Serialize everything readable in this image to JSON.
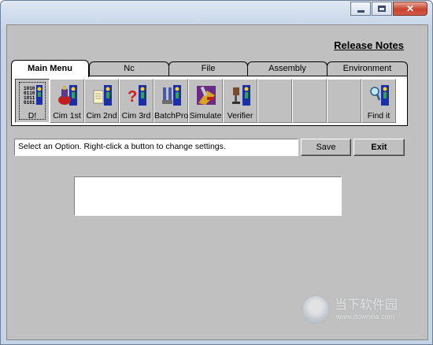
{
  "window": {
    "title": "",
    "caption_buttons": [
      {
        "name": "minimize",
        "icon": "minimize-icon"
      },
      {
        "name": "maximize",
        "icon": "maximize-icon"
      },
      {
        "name": "close",
        "icon": "close-icon",
        "glyph": "✕"
      }
    ]
  },
  "header": {
    "release_notes": "Release Notes"
  },
  "tabs": [
    {
      "label": "Main Menu",
      "active": true
    },
    {
      "label": "Nc",
      "active": false
    },
    {
      "label": "File",
      "active": false
    },
    {
      "label": "Assembly",
      "active": false
    },
    {
      "label": "Environment",
      "active": false
    }
  ],
  "toolbar": {
    "buttons": [
      {
        "label": "D!",
        "icon": "binary-data-icon",
        "pressed": true
      },
      {
        "label": "Cim 1st",
        "icon": "cim-1st-icon"
      },
      {
        "label": "Cim 2nd",
        "icon": "cim-2nd-icon"
      },
      {
        "label": "Cim 3rd",
        "icon": "cim-3rd-icon"
      },
      {
        "label": "BatchPro",
        "icon": "batchpro-icon"
      },
      {
        "label": "Simulate",
        "icon": "simulate-icon"
      },
      {
        "label": "Verifier",
        "icon": "verifier-icon"
      },
      {
        "label": "",
        "icon": ""
      },
      {
        "label": "",
        "icon": ""
      },
      {
        "label": "",
        "icon": ""
      },
      {
        "label": "Find it",
        "icon": "find-it-icon"
      }
    ]
  },
  "status": {
    "message": "Select an Option. Right-click a button to change settings.",
    "save_label": "Save",
    "exit_label": "Exit"
  },
  "watermark": {
    "text_cn": "当下软件园",
    "url": "www.downxia.com"
  },
  "colors": {
    "face": "#c0c0c0",
    "window": "#ffffff",
    "close": "#c8442f",
    "frame": "#c4d3e6"
  }
}
